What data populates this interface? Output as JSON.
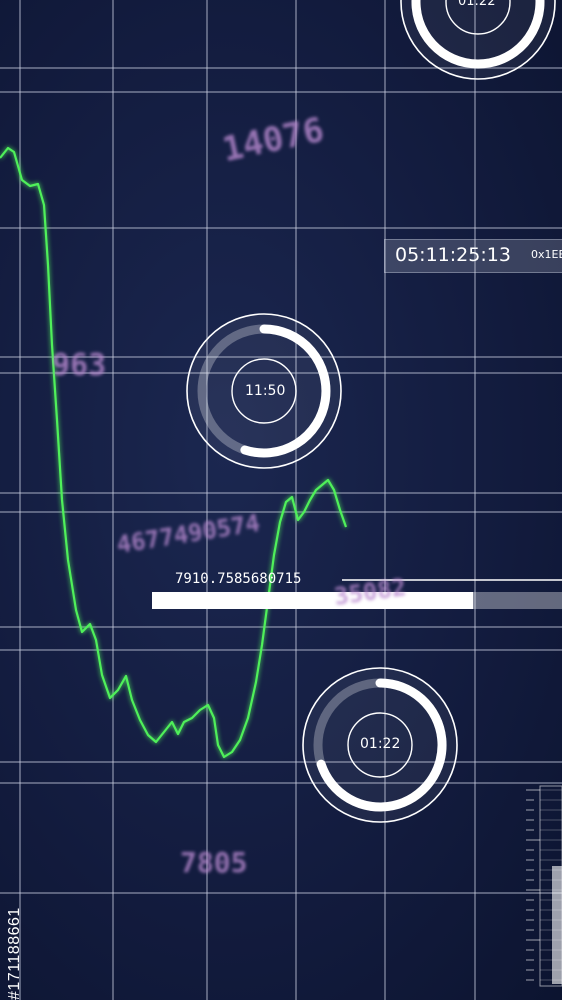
{
  "colors": {
    "background": "#141d40",
    "grid": "#c8cde0",
    "signal_line": "#4ff05a",
    "ghost_text": "#b98ad0",
    "ring": "#ffffff"
  },
  "dials": [
    {
      "label": "01:22",
      "progress": 0.8
    },
    {
      "label": "11:50",
      "progress": 0.55
    },
    {
      "label": "01:22",
      "progress": 0.7
    }
  ],
  "timestamp": "05:11:25:13",
  "hex_code": "0x1EE",
  "readout_value": "7910.7585680715",
  "progress_bar": {
    "fill": 0.9
  },
  "ghost_numbers": {
    "top": "14076",
    "middle_left": "963",
    "middle": "4677490574",
    "right": "35082",
    "bottom": "7805"
  },
  "watermark": "#171188661"
}
